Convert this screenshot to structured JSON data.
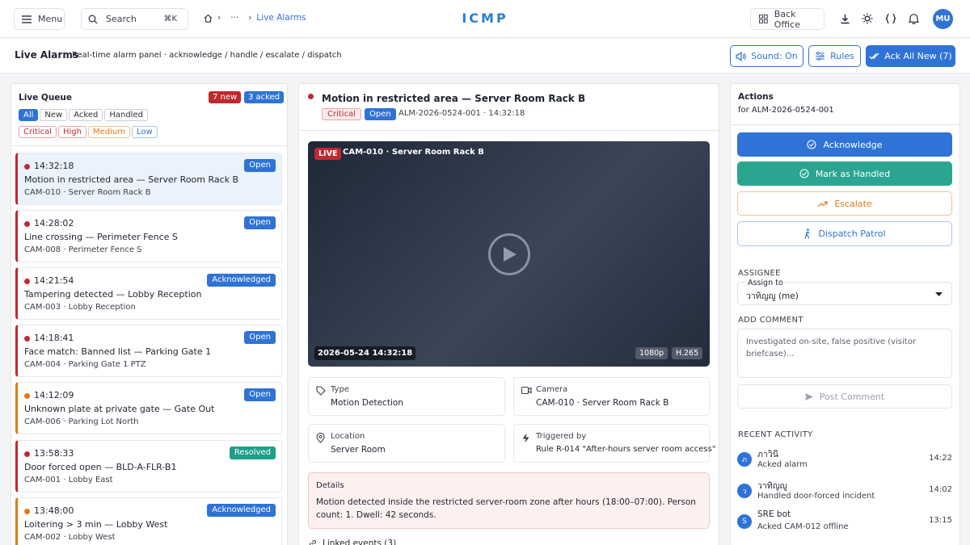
{
  "app": {
    "title": "ICMP"
  },
  "topbar": {
    "menu_label": "Menu",
    "search_label": "Search",
    "search_shortcut": "⌘K",
    "breadcrumb_more": "···",
    "breadcrumb_current": "Live Alarms",
    "back_office_label": "Back Office",
    "avatar_initials": "MU"
  },
  "page": {
    "title": "Live Alarms",
    "subtitle": "Real-time alarm panel · acknowledge / handle / escalate / dispatch"
  },
  "toolbar": {
    "sound_label": "Sound: On",
    "rules_label": "Rules",
    "ack_all_label": "Ack All New (7)"
  },
  "queue": {
    "title": "Live Queue",
    "new_badge": "7 new",
    "acked_badge": "3 acked",
    "filters": [
      "All",
      "New",
      "Acked",
      "Handled"
    ],
    "severity_filters": [
      "Critical",
      "High",
      "Medium",
      "Low"
    ],
    "items": [
      {
        "time": "14:32:18",
        "title": "Motion in restricted area — Server Room Rack B",
        "camera": "CAM-010 · Server Room Rack B",
        "status": "Open",
        "severity": "critical"
      },
      {
        "time": "14:28:02",
        "title": "Line crossing — Perimeter Fence S",
        "camera": "CAM-008 · Perimeter Fence S",
        "status": "Open",
        "severity": "critical"
      },
      {
        "time": "14:21:54",
        "title": "Tampering detected — Lobby Reception",
        "camera": "CAM-003 · Lobby Reception",
        "status": "Acknowledged",
        "severity": "critical"
      },
      {
        "time": "14:18:41",
        "title": "Face match: Banned list — Parking Gate 1",
        "camera": "CAM-004 · Parking Gate 1 PTZ",
        "status": "Open",
        "severity": "critical"
      },
      {
        "time": "14:12:09",
        "title": "Unknown plate at private gate — Gate Out",
        "camera": "CAM-006 · Parking Lot North",
        "status": "Open",
        "severity": "high"
      },
      {
        "time": "13:58:33",
        "title": "Door forced open — BLD-A-FLR-B1",
        "camera": "CAM-001 · Lobby East",
        "status": "Resolved",
        "severity": "critical"
      },
      {
        "time": "13:48:00",
        "title": "Loitering > 3 min — Lobby West",
        "camera": "CAM-002 · Lobby West",
        "status": "Acknowledged",
        "severity": "high"
      }
    ]
  },
  "detail": {
    "title": "Motion in restricted area — Server Room Rack B",
    "severity": "Critical",
    "status": "Open",
    "meta": "ALM-2026-0524-001 · 14:32:18",
    "video": {
      "live_badge": "LIVE",
      "camera": "CAM-010 · Server Room Rack B",
      "timestamp": "2026-05-24 14:32:18",
      "resolution": "1080p",
      "codec": "H.265"
    },
    "info": [
      {
        "label": "Type",
        "value": "Motion Detection"
      },
      {
        "label": "Camera",
        "value": "CAM-010 · Server Room Rack B"
      },
      {
        "label": "Location",
        "value": "Server Room"
      },
      {
        "label": "Triggered by",
        "value": "Rule R-014 \"After-hours server room access\""
      }
    ],
    "details_title": "Details",
    "details_text": "Motion detected inside the restricted server-room zone after hours (18:00–07:00). Person count: 1. Dwell: 42 seconds.",
    "linked_events": "Linked events (3)"
  },
  "actions": {
    "title": "Actions",
    "subtitle": "for ALM-2026-0524-001",
    "acknowledge": "Acknowledge",
    "mark_handled": "Mark as Handled",
    "escalate": "Escalate",
    "dispatch": "Dispatch Patrol",
    "assignee_heading": "ASSIGNEE",
    "assign_to_label": "Assign to",
    "assign_to_value": "วาทิญญู (me)",
    "comment_heading": "ADD COMMENT",
    "comment_text": "Investigated on-site, false positive (visitor briefcase)...",
    "post_comment": "Post Comment",
    "activity_heading": "RECENT ACTIVITY",
    "activity": [
      {
        "initial": "ภ",
        "who": "ภาวินี",
        "what": "Acked alarm",
        "time": "14:22"
      },
      {
        "initial": "ว",
        "who": "วาทิญญู",
        "what": "Handled door-forced incident",
        "time": "14:02"
      },
      {
        "initial": "S",
        "who": "SRE bot",
        "what": "Acked CAM-012 offline",
        "time": "13:15"
      }
    ]
  },
  "colors": {
    "accent": "#2f73d6",
    "critical": "#c0292f",
    "high": "#e07a18",
    "resolved": "#1f9e8a",
    "handled_button": "#2aa58f"
  }
}
